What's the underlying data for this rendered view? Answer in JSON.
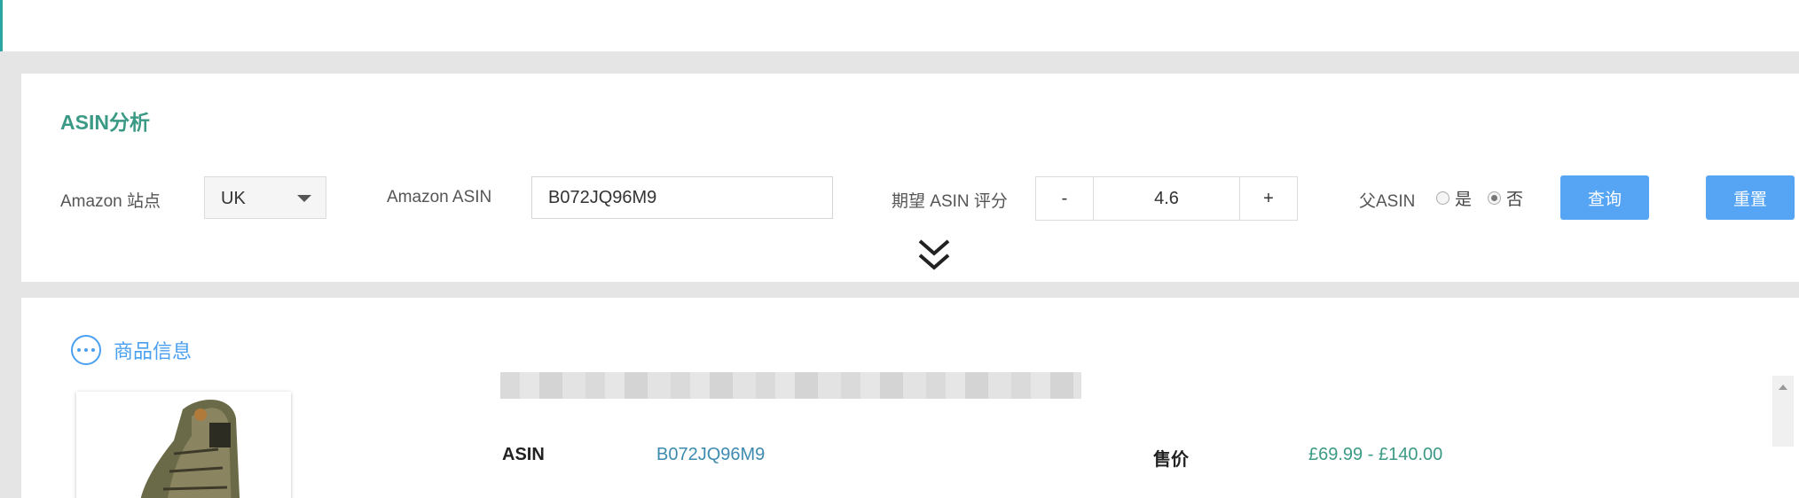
{
  "search_panel": {
    "title": "ASIN分析",
    "site_label": "Amazon 站点",
    "site_value": "UK",
    "asin_label": "Amazon ASIN",
    "asin_value": "B072JQ96M9",
    "rating_label": "期望 ASIN 评分",
    "rating_minus": "-",
    "rating_value": "4.6",
    "rating_plus": "+",
    "parent_label": "父ASIN",
    "parent_options": [
      {
        "label": "是",
        "checked": false
      },
      {
        "label": "否",
        "checked": true
      }
    ],
    "query_button": "查询",
    "reset_button": "重置"
  },
  "product_info": {
    "title": "商品信息",
    "asin_key": "ASIN",
    "asin_value": "B072JQ96M9",
    "price_key": "售价",
    "price_value": "£69.99 - £140.00"
  },
  "colors": {
    "accent_green": "#3b9a85",
    "primary_blue": "#56a5f5",
    "link_blue": "#3d8ab0"
  }
}
